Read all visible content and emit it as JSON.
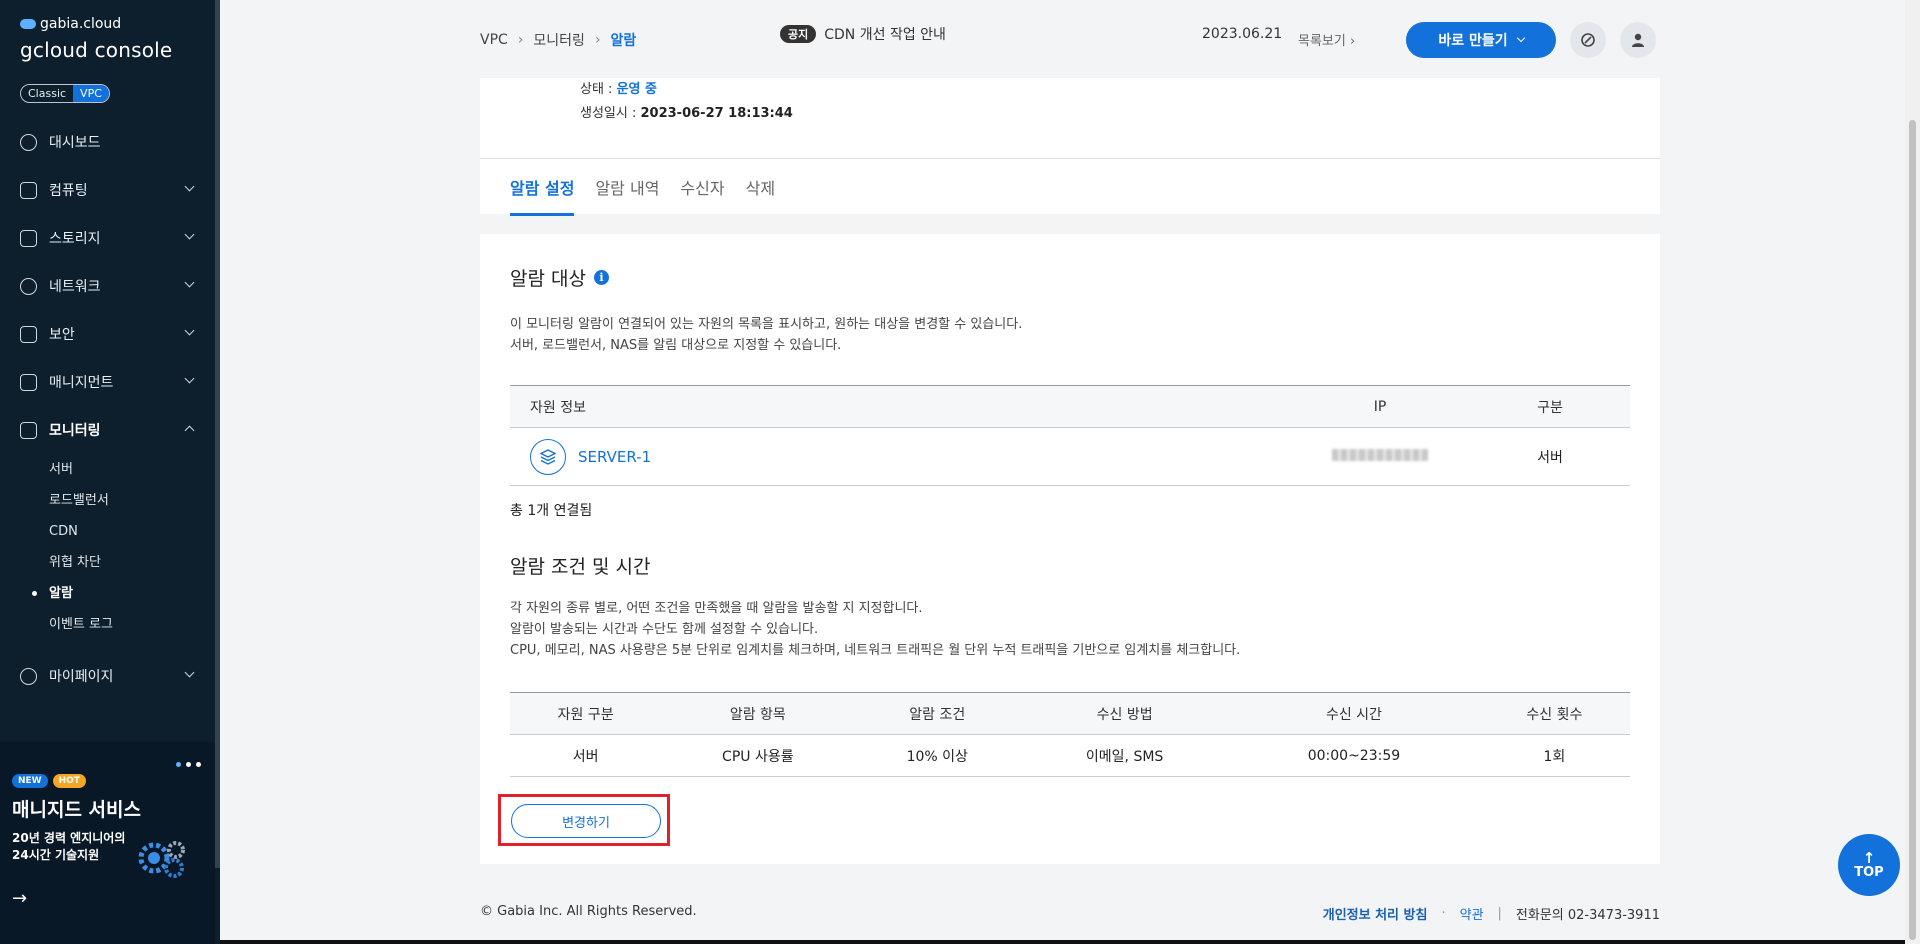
{
  "sidebar": {
    "brand_top": "gabia.cloud",
    "brand_main": "gcloud console",
    "toggle": {
      "classic": "Classic",
      "vpc": "VPC"
    },
    "menu": [
      {
        "label": "대시보드"
      },
      {
        "label": "컴퓨팅"
      },
      {
        "label": "스토리지"
      },
      {
        "label": "네트워크"
      },
      {
        "label": "보안"
      },
      {
        "label": "매니지먼트"
      },
      {
        "label": "모니터링"
      }
    ],
    "submenu": [
      "서버",
      "로드밸런서",
      "CDN",
      "위협 차단",
      "알람",
      "이벤트 로그"
    ],
    "mypage": "마이페이지",
    "promo": {
      "badge_new": "NEW",
      "badge_hot": "HOT",
      "title": "매니지드 서비스",
      "sub": "20년 경력 엔지니어의 24시간 기술지원"
    }
  },
  "header": {
    "breadcrumb": [
      "VPC",
      "모니터링",
      "알람"
    ],
    "notice_tag": "공지",
    "notice_text": "CDN 개선 작업 안내",
    "notice_date": "2023.06.21",
    "notice_list": "목록보기",
    "create_button": "바로 만들기"
  },
  "summary": {
    "status_label": "상태 : ",
    "status_value": "운영 중",
    "created_label": "생성일시 : ",
    "created_value": "2023-06-27 18:13:44"
  },
  "tabs": [
    "알람 설정",
    "알람 내역",
    "수신자",
    "삭제"
  ],
  "target": {
    "title": "알람 대상",
    "desc1": "이 모니터링 알람이 연결되어 있는 자원의 목록을 표시하고, 원하는 대상을 변경할 수 있습니다.",
    "desc2": "서버, 로드밸런서, NAS를 알림 대상으로 지정할 수 있습니다.",
    "columns": [
      "자원 정보",
      "IP",
      "구분"
    ],
    "rows": [
      {
        "name": "SERVER-1",
        "type": "서버"
      }
    ],
    "total": "총 1개 연결됨"
  },
  "condition": {
    "title": "알람 조건 및 시간",
    "desc1": "각 자원의 종류 별로, 어떤 조건을 만족했을 때 알람을 발송할 지 지정합니다.",
    "desc2": "알람이 발송되는 시간과 수단도 함께 설정할 수 있습니다.",
    "desc3": "CPU, 메모리, NAS 사용량은 5분 단위로 임계치를 체크하며, 네트워크 트래픽은 월 단위 누적 트래픽을 기반으로 임계치를 체크합니다.",
    "columns": [
      "자원 구분",
      "알람 항목",
      "알람 조건",
      "수신 방법",
      "수신 시간",
      "수신 횟수"
    ],
    "row": [
      "서버",
      "CPU 사용률",
      "10% 이상",
      "이메일, SMS",
      "00:00~23:59",
      "1회"
    ],
    "change_button": "변경하기"
  },
  "footer": {
    "copyright": "© Gabia Inc. All Rights Reserved.",
    "privacy": "개인정보 처리 방침",
    "terms": "약관",
    "phone": "전화문의  02-3473-3911"
  },
  "top_button": "TOP"
}
